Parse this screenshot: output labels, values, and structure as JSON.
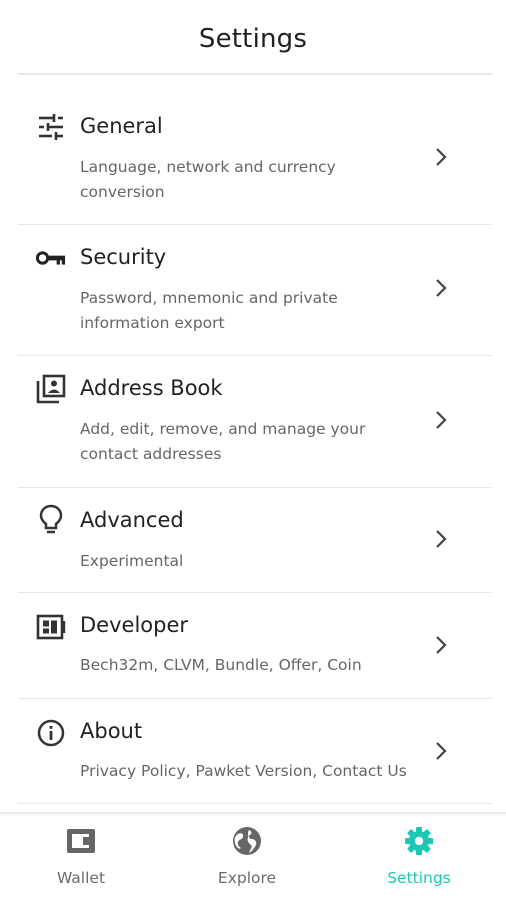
{
  "header": {
    "title": "Settings"
  },
  "settings": {
    "items": [
      {
        "label": "General",
        "desc": "Language, network and currency conversion",
        "icon": "sliders-icon"
      },
      {
        "label": "Security",
        "desc": "Password, mnemonic and private information export",
        "icon": "key-icon"
      },
      {
        "label": "Address Book",
        "desc": "Add, edit, remove, and manage your contact addresses",
        "icon": "contacts-icon"
      },
      {
        "label": "Advanced",
        "desc": "Experimental",
        "icon": "lightbulb-icon"
      },
      {
        "label": "Developer",
        "desc": "Bech32m, CLVM, Bundle, Offer, Coin",
        "icon": "chip-icon"
      },
      {
        "label": "About",
        "desc": "Privacy Policy, Pawket Version, Contact Us",
        "icon": "info-icon"
      }
    ]
  },
  "tabs": {
    "items": [
      {
        "label": "Wallet",
        "icon": "wallet-icon",
        "active": false
      },
      {
        "label": "Explore",
        "icon": "globe-icon",
        "active": false
      },
      {
        "label": "Settings",
        "icon": "gear-icon",
        "active": true
      }
    ],
    "active_color": "#1cc7b4"
  }
}
